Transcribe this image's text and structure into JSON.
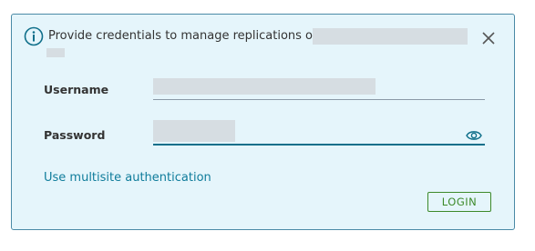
{
  "alert": {
    "message": "Provide credentials to manage replications on",
    "icon": "info-icon",
    "close_icon": "close-icon"
  },
  "form": {
    "username_label": "Username",
    "password_label": "Password",
    "password_toggle_icon": "eye-icon",
    "multisite_link": "Use multisite authentication",
    "login_label": "LOGIN"
  },
  "colors": {
    "background": "#e5f5fb",
    "border": "#4a8aa6",
    "link": "#0f7c9b",
    "login": "#3d8a2a"
  }
}
